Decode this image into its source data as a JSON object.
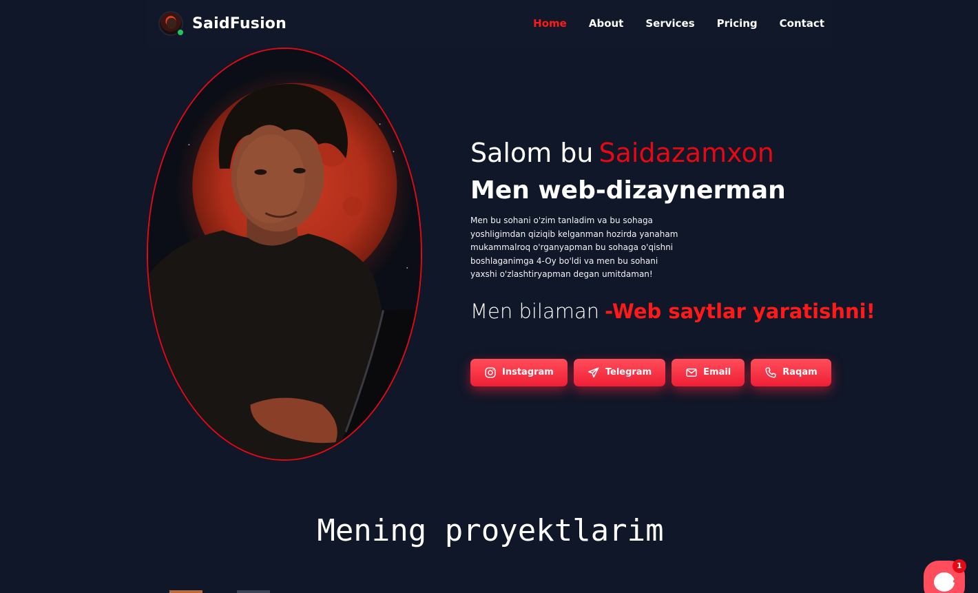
{
  "header": {
    "brand": "SaidFusion",
    "nav": [
      {
        "label": "Home",
        "active": true
      },
      {
        "label": "About",
        "active": false
      },
      {
        "label": "Services",
        "active": false
      },
      {
        "label": "Pricing",
        "active": false
      },
      {
        "label": "Contact",
        "active": false
      }
    ]
  },
  "hero": {
    "greeting": "Salom bu",
    "name": "Saidazamxon",
    "role": "Men web-dizaynerman",
    "bio": "Men bu sohani o'zim tanladim va bu sohaga yoshligimdan qiziqib kelganman hozirda yanaham mukammalroq o'rganyapman bu sohaga o'qishni boshlaganimga 4-Oy bo'ldi va men bu sohani yaxshi o'zlashtiryapman degan umitdaman!",
    "knows_prefix": "Men bilaman",
    "skill": "-Web saytlar yaratishni!"
  },
  "socials": [
    {
      "label": "Instagram",
      "icon": "instagram-icon"
    },
    {
      "label": "Telegram",
      "icon": "telegram-icon"
    },
    {
      "label": "Email",
      "icon": "email-icon"
    },
    {
      "label": "Raqam",
      "icon": "phone-icon"
    }
  ],
  "projects": {
    "title": "Mening proyektlarim"
  },
  "chat": {
    "badge": "1"
  },
  "colors": {
    "background": "#101728",
    "accent": "#e50914",
    "button": "#ef1f36",
    "online": "#22c55e"
  }
}
